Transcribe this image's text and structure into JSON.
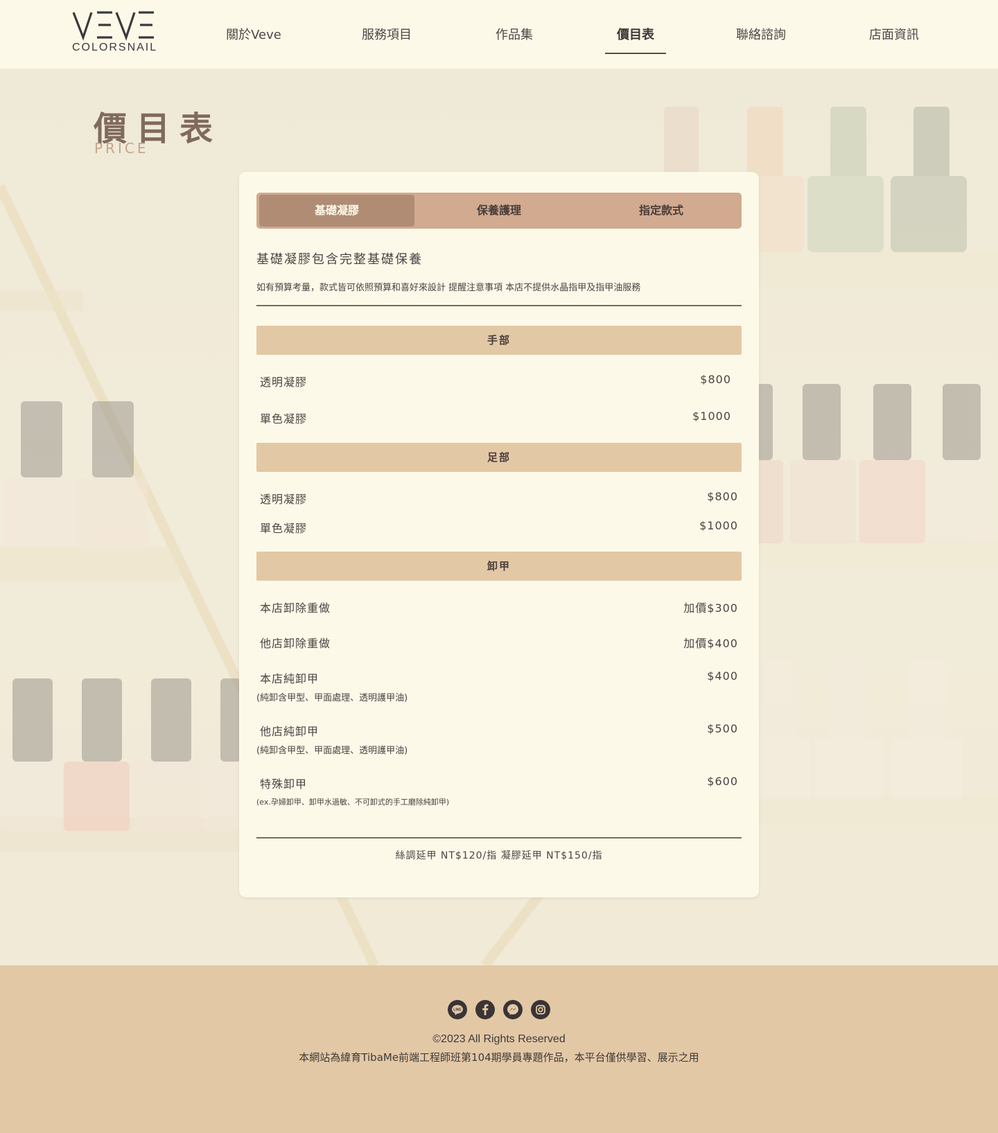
{
  "brand": {
    "logo_text": "VEVE",
    "logo_sub": "COLORSNAIL"
  },
  "nav": {
    "items": [
      {
        "label": "關於Veve"
      },
      {
        "label": "服務項目"
      },
      {
        "label": "作品集"
      },
      {
        "label": "價目表",
        "active": true
      },
      {
        "label": "聯絡諮詢"
      },
      {
        "label": "店面資訊"
      }
    ]
  },
  "page": {
    "title": "價目表",
    "subtitle": "PRICE"
  },
  "tabs": [
    "基礎凝膠",
    "保養護理",
    "指定款式"
  ],
  "intro": {
    "title": "基礎凝膠包含完整基礎保養",
    "note": "如有預算考量，款式皆可依照預算和喜好來設計  提醒注意事項  本店不提供水晶指甲及指甲油服務"
  },
  "sections": {
    "hand": {
      "title": "手部",
      "items": [
        {
          "name": "透明凝膠",
          "price": "$800"
        },
        {
          "name": "單色凝膠",
          "price": "$1000"
        }
      ]
    },
    "foot": {
      "title": "足部",
      "items": [
        {
          "name": "透明凝膠",
          "price": "$800"
        },
        {
          "name": "單色凝膠",
          "price": "$1000"
        }
      ]
    },
    "removal": {
      "title": "卸甲",
      "items": [
        {
          "name": "本店卸除重做",
          "price": "加價$300"
        },
        {
          "name": "他店卸除重做",
          "price": "加價$400"
        },
        {
          "name": "本店純卸甲",
          "price": "$400",
          "note": "(純卸含甲型、甲面處理、透明護甲油)"
        },
        {
          "name": "他店純卸甲",
          "price": "$500",
          "note": "(純卸含甲型、甲面處理、透明護甲油)"
        },
        {
          "name": "特殊卸甲",
          "price": "$600",
          "note": "(ex.孕婦卸甲、卸甲水過敏、不可卸式的手工磨除純卸甲)"
        }
      ]
    }
  },
  "extension": "絲調延甲 NT$120/指    凝膠延甲 NT$150/指",
  "footer": {
    "socials": [
      "line-icon",
      "facebook-icon",
      "messenger-icon",
      "instagram-icon"
    ],
    "copyright": "©2023 All Rights Reserved",
    "disclaimer": "本網站為緯育TibaMe前端工程師班第104期學員專題作品，本平台僅供學習、展示之用"
  },
  "colors": {
    "background": "#fdf9e8",
    "tab_bar": "#d1aa90",
    "tab_active": "#b08c75",
    "section_head": "#e3c8a5",
    "footer": "#e3c8a6",
    "title": "#806a5e",
    "subtitle": "#c7a58b"
  }
}
